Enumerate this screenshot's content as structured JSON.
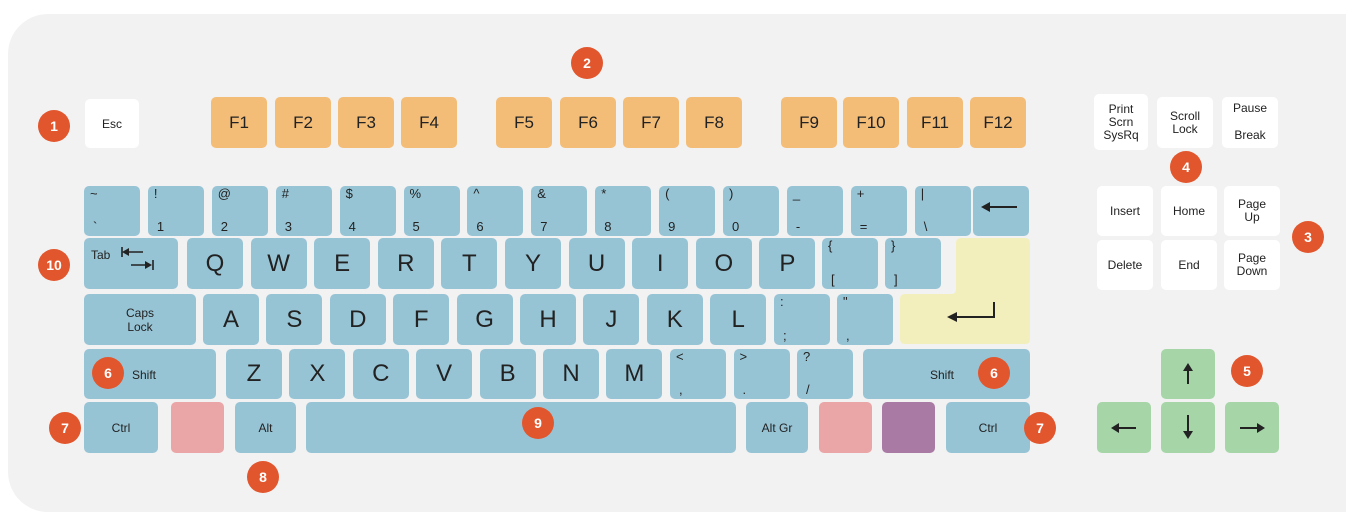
{
  "badges": [
    "1",
    "2",
    "3",
    "4",
    "5",
    "6",
    "6",
    "7",
    "7",
    "8",
    "9",
    "10"
  ],
  "function_row": {
    "esc": "Esc",
    "fkeys": [
      "F1",
      "F2",
      "F3",
      "F4",
      "F5",
      "F6",
      "F7",
      "F8",
      "F9",
      "F10",
      "F11",
      "F12"
    ]
  },
  "number_row": [
    {
      "top": "~",
      "bottom": "`"
    },
    {
      "top": "!",
      "bottom": "1"
    },
    {
      "top": "@",
      "bottom": "2"
    },
    {
      "top": "#",
      "bottom": "3"
    },
    {
      "top": "$",
      "bottom": "4"
    },
    {
      "top": "%",
      "bottom": "5"
    },
    {
      "top": "^",
      "bottom": "6"
    },
    {
      "top": "&",
      "bottom": "7"
    },
    {
      "top": "*",
      "bottom": "8"
    },
    {
      "top": "(",
      "bottom": "9"
    },
    {
      "top": ")",
      "bottom": "0"
    },
    {
      "top": "_",
      "bottom": "-"
    },
    {
      "top": "+",
      "bottom": "="
    },
    {
      "top": "|",
      "bottom": "\\"
    }
  ],
  "tab_row": {
    "tab": "Tab",
    "letters": [
      "Q",
      "W",
      "E",
      "R",
      "T",
      "Y",
      "U",
      "I",
      "O",
      "P"
    ],
    "brackets": [
      {
        "top": "{",
        "bottom": "["
      },
      {
        "top": "}",
        "bottom": "]"
      }
    ]
  },
  "caps_row": {
    "caps": "Caps\nLock",
    "letters": [
      "A",
      "S",
      "D",
      "F",
      "G",
      "H",
      "J",
      "K",
      "L"
    ],
    "symbols": [
      {
        "top": ":",
        "bottom": ";"
      },
      {
        "top": "\"",
        "bottom": ","
      }
    ]
  },
  "shift_row": {
    "left_shift": "Shift",
    "right_shift": "Shift",
    "letters": [
      "Z",
      "X",
      "C",
      "V",
      "B",
      "N",
      "M"
    ],
    "symbols": [
      {
        "top": "<",
        "bottom": ","
      },
      {
        "top": ">",
        "bottom": "."
      },
      {
        "top": "?",
        "bottom": "/"
      }
    ]
  },
  "bottom_row": {
    "ctrl_left": "Ctrl",
    "alt": "Alt",
    "alt_gr": "Alt Gr",
    "ctrl_right": "Ctrl"
  },
  "system_keys": {
    "print": "Print\nScrn\nSysRq",
    "scroll": "Scroll\nLock",
    "pause": "Pause",
    "break": "Break"
  },
  "nav_keys": {
    "insert": "Insert",
    "home": "Home",
    "page_up": "Page\nUp",
    "delete": "Delete",
    "end": "End",
    "page_down": "Page\nDown"
  },
  "colors": {
    "standard": "#97c4d5",
    "function": "#f3bd78",
    "system": "#ffffff",
    "arrows": "#a6d6a8",
    "enter": "#f2efbd",
    "windows": "#eaa5a7",
    "menu": "#a97aa4",
    "badge": "#e2562d",
    "background": "#f2f2f2"
  }
}
